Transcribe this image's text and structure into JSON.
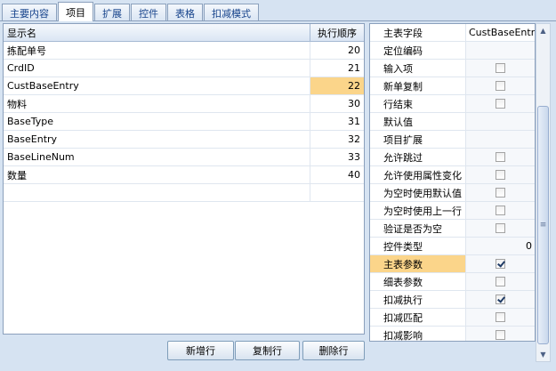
{
  "tabs": [
    "主要内容",
    "项目",
    "扩展",
    "控件",
    "表格",
    "扣减模式"
  ],
  "active_tab": 1,
  "left_grid": {
    "headers": [
      "显示名",
      "执行顺序"
    ],
    "rows": [
      {
        "name": "拣配单号",
        "order": "20"
      },
      {
        "name": "CrdID",
        "order": "21"
      },
      {
        "name": "CustBaseEntry",
        "order": "22"
      },
      {
        "name": "物料",
        "order": "30"
      },
      {
        "name": "BaseType",
        "order": "31"
      },
      {
        "name": "BaseEntry",
        "order": "32"
      },
      {
        "name": "BaseLineNum",
        "order": "33"
      },
      {
        "name": "数量",
        "order": "40"
      },
      {
        "name": "",
        "order": ""
      }
    ],
    "selected_row": 2
  },
  "buttons": {
    "add": "新增行",
    "copy": "复制行",
    "delete": "删除行"
  },
  "property_grid": {
    "rows": [
      {
        "name": "主表字段",
        "type": "text",
        "value": "CustBaseEntry"
      },
      {
        "name": "定位编码",
        "type": "empty",
        "value": ""
      },
      {
        "name": "输入项",
        "type": "check",
        "checked": false
      },
      {
        "name": "新单复制",
        "type": "check",
        "checked": false
      },
      {
        "name": "行结束",
        "type": "check",
        "checked": false
      },
      {
        "name": "默认值",
        "type": "empty",
        "value": ""
      },
      {
        "name": "项目扩展",
        "type": "empty",
        "value": ""
      },
      {
        "name": "允许跳过",
        "type": "check",
        "checked": false
      },
      {
        "name": "允许使用属性变化",
        "type": "check",
        "checked": false
      },
      {
        "name": "为空时使用默认值",
        "type": "check",
        "checked": false
      },
      {
        "name": "为空时使用上一行",
        "type": "check",
        "checked": false
      },
      {
        "name": "验证是否为空",
        "type": "check",
        "checked": false
      },
      {
        "name": "控件类型",
        "type": "num",
        "value": "0"
      },
      {
        "name": "主表参数",
        "type": "check",
        "checked": true
      },
      {
        "name": "细表参数",
        "type": "check",
        "checked": false
      },
      {
        "name": "扣减执行",
        "type": "check",
        "checked": true
      },
      {
        "name": "扣减匹配",
        "type": "check",
        "checked": false
      },
      {
        "name": "扣减影响",
        "type": "check",
        "checked": false
      }
    ],
    "selected_row": 13
  },
  "colors": {
    "highlight": "#fbd58a",
    "border": "#8ba0bc",
    "background": "#d6e3f2"
  }
}
